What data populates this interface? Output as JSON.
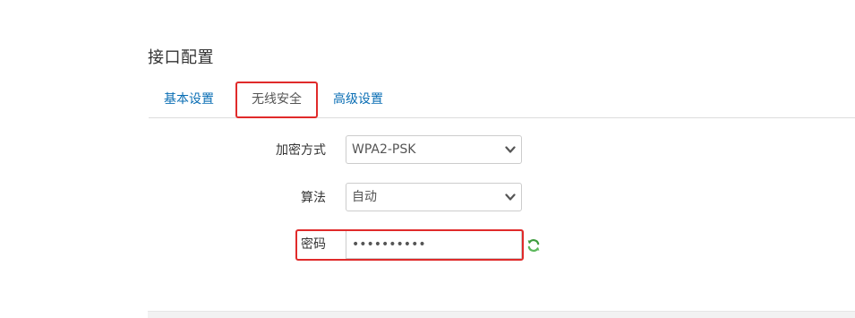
{
  "section": {
    "title": "接口配置"
  },
  "tabs": [
    {
      "label": "基本设置",
      "active": false
    },
    {
      "label": "无线安全",
      "active": true
    },
    {
      "label": "高级设置",
      "active": false
    }
  ],
  "form": {
    "encryption": {
      "label": "加密方式",
      "value": "WPA2-PSK"
    },
    "cipher": {
      "label": "算法",
      "value": "自动"
    },
    "password": {
      "label": "密码",
      "value": "••••••••••"
    }
  },
  "icons": {
    "select_chevron": "chevron-down-icon",
    "password_reveal": "refresh-icon"
  },
  "colors": {
    "link": "#0a6eb4",
    "highlight": "#e02a2a",
    "refresh_green": "#4caf50"
  }
}
